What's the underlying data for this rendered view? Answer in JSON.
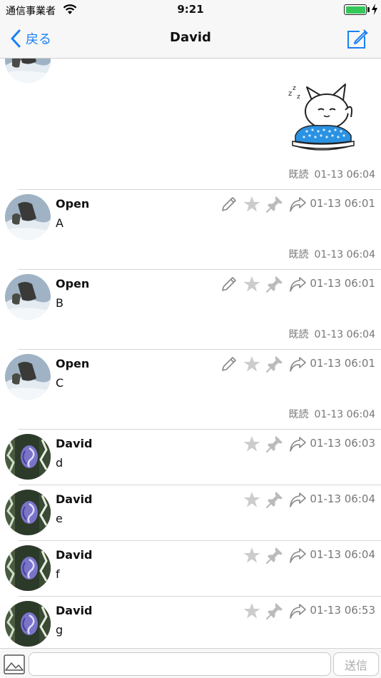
{
  "status_bar": {
    "carrier": "通信事業者",
    "time": "9:21",
    "battery_level": 1.0
  },
  "nav": {
    "back_label": "戻る",
    "title": "David",
    "compose_icon": "compose-icon"
  },
  "sticker_message": {
    "sticker": "sleeping-cat-sticker",
    "read_label": "既読",
    "timestamp": "01-13 06:04"
  },
  "messages": [
    {
      "author": "Open",
      "text": "A",
      "time": "01-13 06:01",
      "editable": true,
      "read_label": "既読",
      "read_time": "01-13 06:04"
    },
    {
      "author": "Open",
      "text": "B",
      "time": "01-13 06:01",
      "editable": true,
      "read_label": "既読",
      "read_time": "01-13 06:04"
    },
    {
      "author": "Open",
      "text": "C",
      "time": "01-13 06:01",
      "editable": true,
      "read_label": "既読",
      "read_time": "01-13 06:04"
    },
    {
      "author": "David",
      "text": "d",
      "time": "01-13 06:03",
      "editable": false
    },
    {
      "author": "David",
      "text": "e",
      "time": "01-13 06:04",
      "editable": false
    },
    {
      "author": "David",
      "text": "f",
      "time": "01-13 06:04",
      "editable": false
    },
    {
      "author": "David",
      "text": "g",
      "time": "01-13 06:53",
      "editable": false
    }
  ],
  "input_bar": {
    "image_icon": "image-icon",
    "placeholder": "",
    "send_label": "送信"
  },
  "colors": {
    "accent": "#1a7ff5",
    "icon_gray": "#c8c8c8",
    "meta_text": "#777777",
    "battery": "#35c759"
  }
}
